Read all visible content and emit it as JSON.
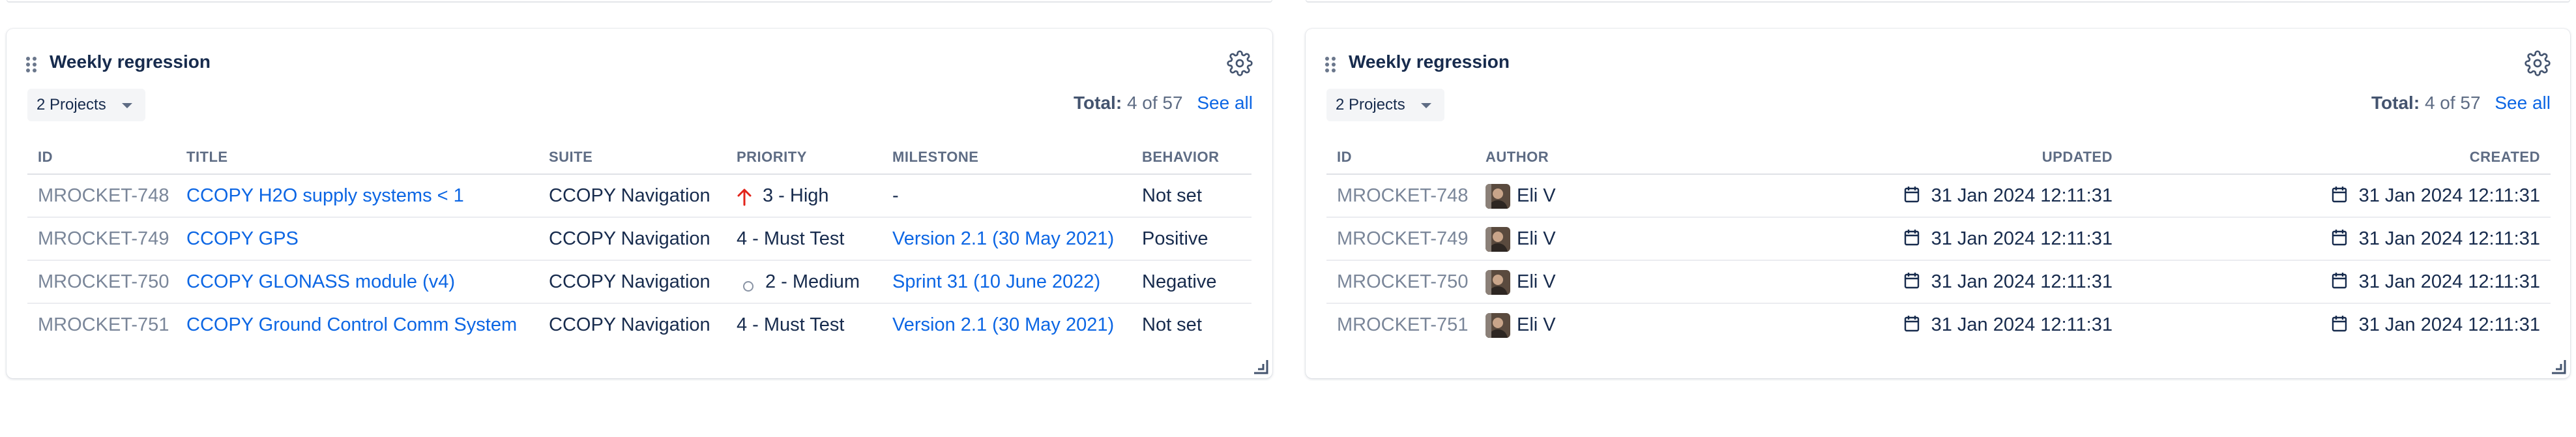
{
  "widgets": [
    {
      "title": "Weekly regression",
      "projects": "2 Projects",
      "total_label": "Total:",
      "total_value": "4 of 57",
      "see_all": "See all",
      "columns": [
        "ID",
        "TITLE",
        "SUITE",
        "PRIORITY",
        "MILESTONE",
        "BEHAVIOR"
      ],
      "rows": [
        {
          "id": "MROCKET-748",
          "title": "CCOPY H2O supply systems < 1",
          "suite": "CCOPY Navigation",
          "priority": "3 - High",
          "priority_icon": "arrow-up-icon",
          "milestone": "-",
          "behavior": "Not set"
        },
        {
          "id": "MROCKET-749",
          "title": "CCOPY GPS",
          "suite": "CCOPY Navigation",
          "priority": "4 - Must Test",
          "priority_icon": "",
          "milestone": "Version 2.1 (30 May 2021)",
          "behavior": "Positive"
        },
        {
          "id": "MROCKET-750",
          "title": "CCOPY GLONASS module (v4)",
          "suite": "CCOPY Navigation",
          "priority": "2 - Medium",
          "priority_icon": "circle-icon",
          "milestone": "Sprint 31 (10 June 2022)",
          "behavior": "Negative"
        },
        {
          "id": "MROCKET-751",
          "title": "CCOPY Ground Control Comm System",
          "suite": "CCOPY Navigation",
          "priority": "4 - Must Test",
          "priority_icon": "",
          "milestone": "Version 2.1 (30 May 2021)",
          "behavior": "Not set"
        }
      ]
    },
    {
      "title": "Weekly regression",
      "projects": "2 Projects",
      "total_label": "Total:",
      "total_value": "4 of 57",
      "see_all": "See all",
      "columns": [
        "ID",
        "AUTHOR",
        "UPDATED",
        "CREATED"
      ],
      "rows": [
        {
          "id": "MROCKET-748",
          "author": "Eli V",
          "updated": "31 Jan 2024 12:11:31",
          "created": "31 Jan 2024 12:11:31"
        },
        {
          "id": "MROCKET-749",
          "author": "Eli V",
          "updated": "31 Jan 2024 12:11:31",
          "created": "31 Jan 2024 12:11:31"
        },
        {
          "id": "MROCKET-750",
          "author": "Eli V",
          "updated": "31 Jan 2024 12:11:31",
          "created": "31 Jan 2024 12:11:31"
        },
        {
          "id": "MROCKET-751",
          "author": "Eli V",
          "updated": "31 Jan 2024 12:11:31",
          "created": "31 Jan 2024 12:11:31"
        }
      ]
    }
  ],
  "colors": {
    "link": "#0c66e4",
    "priority_high": "#e2231a",
    "text": "#172b4d",
    "muted": "#7a8699"
  }
}
